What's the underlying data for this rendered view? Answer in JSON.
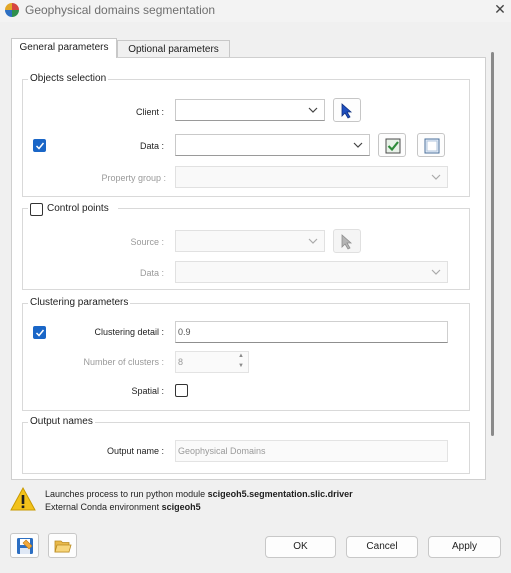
{
  "window": {
    "title": "Geophysical domains segmentation",
    "close_glyph": "✕",
    "app_icon": "globe-icon"
  },
  "tabs": [
    {
      "label": "General parameters",
      "active": true
    },
    {
      "label": "Optional parameters",
      "active": false
    }
  ],
  "objects_selection": {
    "legend": "Objects selection",
    "client_label": "Client :",
    "client_value": "",
    "data_label": "Data :",
    "data_checked": true,
    "data_value": "",
    "property_group_label": "Property group :",
    "property_group_value": ""
  },
  "control_points": {
    "legend": "Control points",
    "checked": false,
    "source_label": "Source :",
    "source_value": "",
    "data_label": "Data :",
    "data_value": ""
  },
  "clustering": {
    "legend": "Clustering parameters",
    "detail_label": "Clustering detail :",
    "detail_checked": true,
    "detail_value": "0.9",
    "clusters_label": "Number of clusters :",
    "clusters_value": "8",
    "spatial_label": "Spatial :",
    "spatial_checked": false
  },
  "output": {
    "legend": "Output names",
    "name_label": "Output name :",
    "name_placeholder": "Geophysical Domains"
  },
  "info": {
    "line1_prefix": "Launches process to run python module ",
    "line1_module": "scigeoh5.segmentation.slic.driver",
    "line2_prefix": "External Conda environment ",
    "line2_env": "scigeoh5"
  },
  "buttons": {
    "ok": "OK",
    "cancel": "Cancel",
    "apply": "Apply"
  },
  "colors": {
    "accent": "#1a66c7",
    "warning": "#f2c21b",
    "checkmark_green": "#2e8b3a"
  }
}
